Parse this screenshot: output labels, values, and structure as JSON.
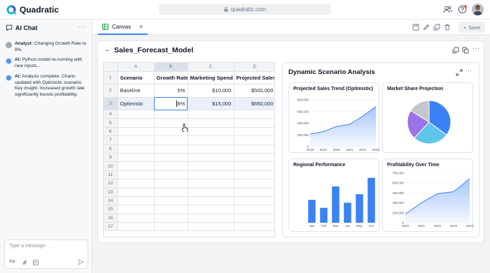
{
  "app": {
    "name": "Quadratic",
    "url": "quadratic.com"
  },
  "sidebar": {
    "title": "AI Chat",
    "messages": [
      {
        "role": "user",
        "speaker": "Analyst:",
        "text": "Changing Growth Rate to 8%."
      },
      {
        "role": "ai",
        "speaker": "AI:",
        "text": "Python model re-running with new inputs..."
      },
      {
        "role": "ai",
        "speaker": "AI:",
        "text": "Analysis complete. Charts updated with Optimistic scenario. Key insight: Increased growth rate significantly boosts profitability."
      }
    ],
    "input_placeholder": "Type a message...",
    "input_tools": [
      "Aa"
    ]
  },
  "tabs": [
    {
      "label": "Canvas"
    }
  ],
  "toolbar": {
    "save_label": "Save"
  },
  "model": {
    "title": "Sales_Forecast_Model"
  },
  "sheet": {
    "columns": [
      "A",
      "B",
      "C",
      "D"
    ],
    "selected_column": "B",
    "selected_row": 3,
    "row_numbers": [
      "1",
      "2",
      "3",
      "4",
      "5",
      "6",
      "7",
      "8",
      "9",
      "10",
      "11",
      "12",
      "13",
      "14",
      "15",
      "16",
      "17"
    ],
    "headers": [
      "Scenario",
      "Growth Rate",
      "Marketing Spend",
      "Projected Sales"
    ],
    "rows": [
      [
        "Baseline",
        "5%",
        "$10,000",
        "$500,000"
      ],
      [
        "Optimistic",
        "8%",
        "$15,000",
        "$650,000"
      ]
    ]
  },
  "dashboard": {
    "title": "Dynamic Scenario Analysis",
    "accent": "#3b82f6"
  },
  "chart_data": [
    {
      "type": "area",
      "title": "Projected Sales Trend (Optimistic)",
      "x": [
        2018,
        2019,
        2020,
        2021,
        2022,
        2023
      ],
      "values": [
        215000,
        255000,
        345000,
        380000,
        520000,
        685000
      ],
      "ylim": [
        0,
        800000
      ],
      "yticks": [
        "0",
        "200,000",
        "400,000",
        "600,000",
        "800,000"
      ],
      "xticks": [
        "2018",
        "2019",
        "2020",
        "2021",
        "2022",
        "2023"
      ],
      "color": "#3b82f6"
    },
    {
      "type": "pie",
      "title": "Market Share Projection",
      "values": [
        35,
        27,
        22,
        16
      ],
      "colors": [
        "#3b82f6",
        "#60c5ea",
        "#9b72e8",
        "#c3c6cb"
      ]
    },
    {
      "type": "bar",
      "title": "Regional Performance",
      "categories": [
        "Jan",
        "Feb",
        "Mar",
        "Apr",
        "May",
        "Jun"
      ],
      "values": [
        112,
        73,
        178,
        98,
        140,
        220
      ],
      "ylim": [
        0,
        250
      ],
      "color": "#3b82f6"
    },
    {
      "type": "area",
      "title": "Profitability Over Time",
      "x": [
        2020,
        2021,
        2022,
        2023,
        2024
      ],
      "values": [
        130000,
        300000,
        440000,
        470000,
        665000
      ],
      "ylim": [
        0,
        750000
      ],
      "yticks": [
        "0",
        "150,000",
        "300,000",
        "450,000",
        "600,000",
        "750,000"
      ],
      "xticks": [
        "2020",
        "2021",
        "2022",
        "2023",
        "2024"
      ],
      "color": "#3b82f6"
    }
  ]
}
